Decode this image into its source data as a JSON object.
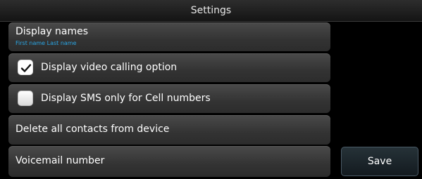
{
  "header": {
    "title": "Settings"
  },
  "settings": {
    "display_names": {
      "label": "Display names",
      "value": "First name Last name"
    },
    "video_calling": {
      "label": "Display video calling option",
      "checked": true
    },
    "sms_only": {
      "label": "Display SMS only for Cell numbers",
      "checked": false
    },
    "delete_contacts": {
      "label": "Delete all contacts from device"
    },
    "voicemail": {
      "label": "Voicemail number"
    }
  },
  "actions": {
    "save_label": "Save"
  },
  "colors": {
    "accent": "#2aa7e6",
    "background": "#000000",
    "item": "#3a3a3a"
  },
  "icons": {
    "checked": "checkmark-icon"
  }
}
